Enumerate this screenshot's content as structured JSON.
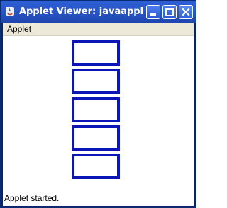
{
  "window": {
    "title": "Applet Viewer: javaapplic...",
    "title_bar_color": "#2a57c9",
    "buttons": {
      "minimize_icon": "minimize-icon",
      "maximize_icon": "maximize-icon",
      "close_icon": "close-icon"
    }
  },
  "menubar": {
    "items": [
      {
        "label": "Applet"
      }
    ]
  },
  "applet": {
    "rectangles_count": 5,
    "rectangle_color": "#0b16b8"
  },
  "status": {
    "text": "Applet started."
  }
}
